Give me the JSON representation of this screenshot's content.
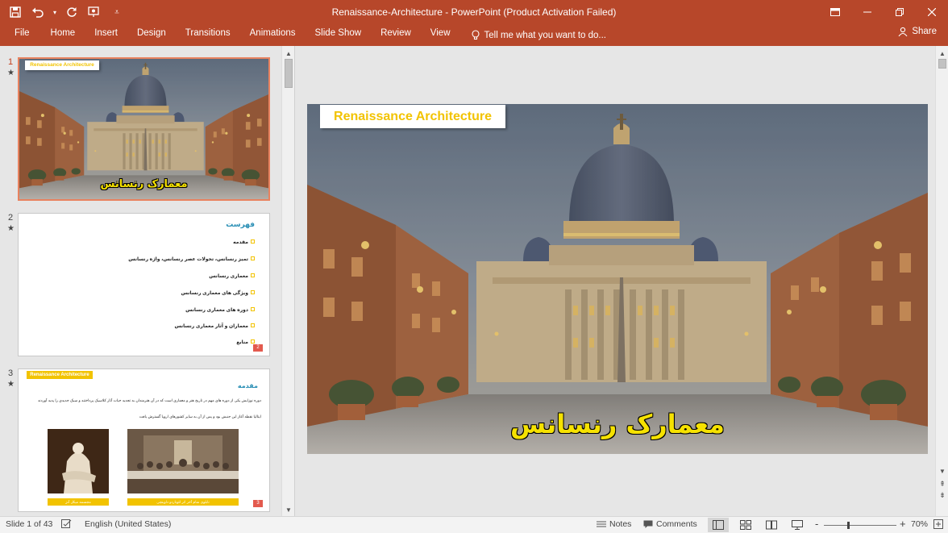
{
  "window": {
    "title": "Renaissance-Architecture - PowerPoint (Product Activation Failed)"
  },
  "quick_access": {
    "save_icon": "save-icon",
    "undo_icon": "undo-icon",
    "redo_icon": "redo-icon",
    "present_icon": "present-icon",
    "customize_icon": "customize-icon"
  },
  "ribbon": {
    "tabs": [
      {
        "label": "File"
      },
      {
        "label": "Home"
      },
      {
        "label": "Insert"
      },
      {
        "label": "Design"
      },
      {
        "label": "Transitions"
      },
      {
        "label": "Animations"
      },
      {
        "label": "Slide Show"
      },
      {
        "label": "Review"
      },
      {
        "label": "View"
      }
    ],
    "tell_me": "Tell me what you want to do...",
    "share": "Share"
  },
  "thumbnails": [
    {
      "number": "1",
      "star": "★",
      "title": "Renaissance Architecture",
      "subtitle": "معمارک رنسانس"
    },
    {
      "number": "2",
      "star": "★",
      "heading": "فهرست",
      "items": [
        "مقدمه",
        "تمیز رنسانس، تحولات عصر رنسانس، واژه رنسانس",
        "معماری رنسانس",
        "ویژگی های معماری رنسانس",
        "دوره های معماری رنسانس",
        "معماران و آثار معماری رنسانس",
        "منابع"
      ],
      "page": "2"
    },
    {
      "number": "3",
      "star": "★",
      "bar": "Renaissance Architecture",
      "heading": "مقدمه",
      "line1": "دوره نوزایش یکی از دوره های مهم در تاریخ هنر و معماری است که در آن هنرمندان به تجدید حیات آثار کلاسیک پرداختند و سبک جدیدی را پدید آوردند",
      "line2": "ایتالیا نقطه آغاز این جنبش بود و پس از آن به سایر کشورهای اروپا گسترش یافت",
      "cap1": "مجسمه میکل آنژ",
      "cap2": "تابلوی شام آخر اثر لئوناردو داوینچی",
      "page": "3"
    }
  ],
  "slide": {
    "title": "Renaissance Architecture",
    "subtitle": "معمارک رنسانس"
  },
  "status": {
    "slide_of": "Slide 1 of 43",
    "language": "English (United States)",
    "notes": "Notes",
    "comments": "Comments",
    "zoom": "70%",
    "zoom_minus": "-",
    "zoom_plus": "+",
    "zoom_level_percent": 70
  },
  "colors": {
    "accent": "#b7472a",
    "title_yellow": "#f2c300",
    "subtitle_yellow": "#f6e200",
    "selected_border": "#e8825f"
  }
}
